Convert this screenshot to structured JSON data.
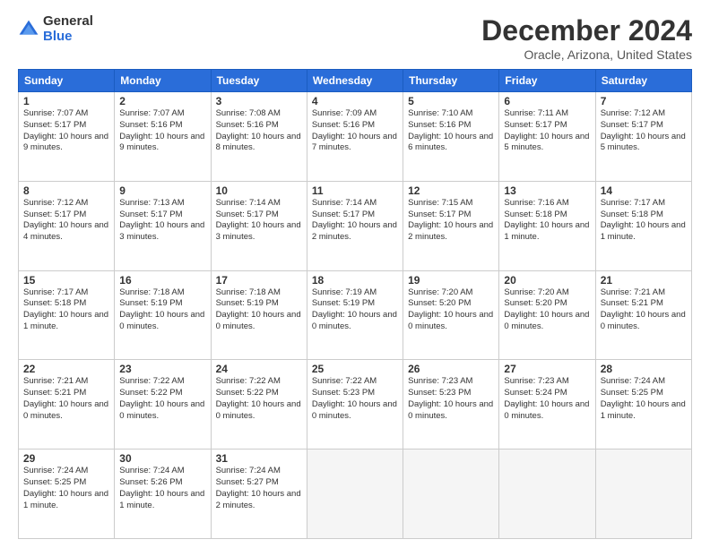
{
  "logo": {
    "general": "General",
    "blue": "Blue"
  },
  "title": "December 2024",
  "location": "Oracle, Arizona, United States",
  "days_of_week": [
    "Sunday",
    "Monday",
    "Tuesday",
    "Wednesday",
    "Thursday",
    "Friday",
    "Saturday"
  ],
  "weeks": [
    [
      {
        "day": 1,
        "sunrise": "7:07 AM",
        "sunset": "5:17 PM",
        "daylight": "10 hours and 9 minutes."
      },
      {
        "day": 2,
        "sunrise": "7:07 AM",
        "sunset": "5:16 PM",
        "daylight": "10 hours and 9 minutes."
      },
      {
        "day": 3,
        "sunrise": "7:08 AM",
        "sunset": "5:16 PM",
        "daylight": "10 hours and 8 minutes."
      },
      {
        "day": 4,
        "sunrise": "7:09 AM",
        "sunset": "5:16 PM",
        "daylight": "10 hours and 7 minutes."
      },
      {
        "day": 5,
        "sunrise": "7:10 AM",
        "sunset": "5:16 PM",
        "daylight": "10 hours and 6 minutes."
      },
      {
        "day": 6,
        "sunrise": "7:11 AM",
        "sunset": "5:17 PM",
        "daylight": "10 hours and 5 minutes."
      },
      {
        "day": 7,
        "sunrise": "7:12 AM",
        "sunset": "5:17 PM",
        "daylight": "10 hours and 5 minutes."
      }
    ],
    [
      {
        "day": 8,
        "sunrise": "7:12 AM",
        "sunset": "5:17 PM",
        "daylight": "10 hours and 4 minutes."
      },
      {
        "day": 9,
        "sunrise": "7:13 AM",
        "sunset": "5:17 PM",
        "daylight": "10 hours and 3 minutes."
      },
      {
        "day": 10,
        "sunrise": "7:14 AM",
        "sunset": "5:17 PM",
        "daylight": "10 hours and 3 minutes."
      },
      {
        "day": 11,
        "sunrise": "7:14 AM",
        "sunset": "5:17 PM",
        "daylight": "10 hours and 2 minutes."
      },
      {
        "day": 12,
        "sunrise": "7:15 AM",
        "sunset": "5:17 PM",
        "daylight": "10 hours and 2 minutes."
      },
      {
        "day": 13,
        "sunrise": "7:16 AM",
        "sunset": "5:18 PM",
        "daylight": "10 hours and 1 minute."
      },
      {
        "day": 14,
        "sunrise": "7:17 AM",
        "sunset": "5:18 PM",
        "daylight": "10 hours and 1 minute."
      }
    ],
    [
      {
        "day": 15,
        "sunrise": "7:17 AM",
        "sunset": "5:18 PM",
        "daylight": "10 hours and 1 minute."
      },
      {
        "day": 16,
        "sunrise": "7:18 AM",
        "sunset": "5:19 PM",
        "daylight": "10 hours and 0 minutes."
      },
      {
        "day": 17,
        "sunrise": "7:18 AM",
        "sunset": "5:19 PM",
        "daylight": "10 hours and 0 minutes."
      },
      {
        "day": 18,
        "sunrise": "7:19 AM",
        "sunset": "5:19 PM",
        "daylight": "10 hours and 0 minutes."
      },
      {
        "day": 19,
        "sunrise": "7:20 AM",
        "sunset": "5:20 PM",
        "daylight": "10 hours and 0 minutes."
      },
      {
        "day": 20,
        "sunrise": "7:20 AM",
        "sunset": "5:20 PM",
        "daylight": "10 hours and 0 minutes."
      },
      {
        "day": 21,
        "sunrise": "7:21 AM",
        "sunset": "5:21 PM",
        "daylight": "10 hours and 0 minutes."
      }
    ],
    [
      {
        "day": 22,
        "sunrise": "7:21 AM",
        "sunset": "5:21 PM",
        "daylight": "10 hours and 0 minutes."
      },
      {
        "day": 23,
        "sunrise": "7:22 AM",
        "sunset": "5:22 PM",
        "daylight": "10 hours and 0 minutes."
      },
      {
        "day": 24,
        "sunrise": "7:22 AM",
        "sunset": "5:22 PM",
        "daylight": "10 hours and 0 minutes."
      },
      {
        "day": 25,
        "sunrise": "7:22 AM",
        "sunset": "5:23 PM",
        "daylight": "10 hours and 0 minutes."
      },
      {
        "day": 26,
        "sunrise": "7:23 AM",
        "sunset": "5:23 PM",
        "daylight": "10 hours and 0 minutes."
      },
      {
        "day": 27,
        "sunrise": "7:23 AM",
        "sunset": "5:24 PM",
        "daylight": "10 hours and 0 minutes."
      },
      {
        "day": 28,
        "sunrise": "7:24 AM",
        "sunset": "5:25 PM",
        "daylight": "10 hours and 1 minute."
      }
    ],
    [
      {
        "day": 29,
        "sunrise": "7:24 AM",
        "sunset": "5:25 PM",
        "daylight": "10 hours and 1 minute."
      },
      {
        "day": 30,
        "sunrise": "7:24 AM",
        "sunset": "5:26 PM",
        "daylight": "10 hours and 1 minute."
      },
      {
        "day": 31,
        "sunrise": "7:24 AM",
        "sunset": "5:27 PM",
        "daylight": "10 hours and 2 minutes."
      },
      null,
      null,
      null,
      null
    ]
  ]
}
